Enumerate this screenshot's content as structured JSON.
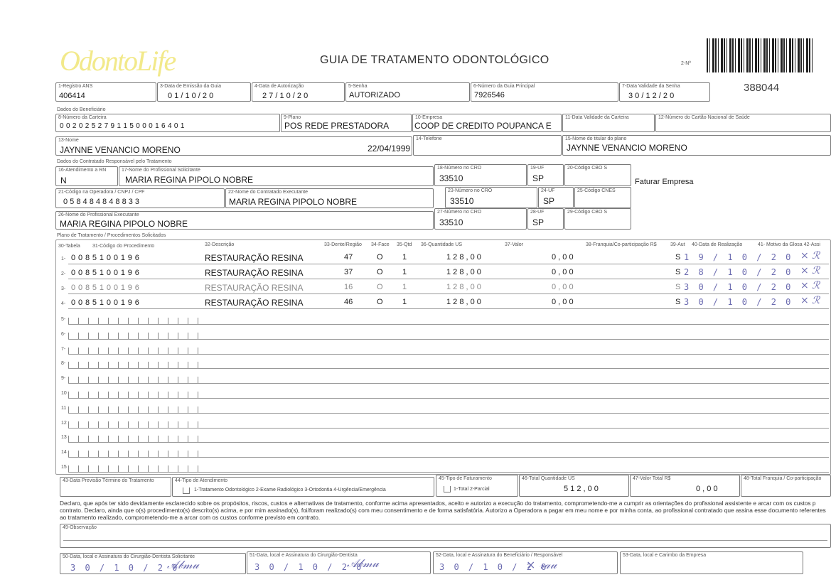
{
  "header": {
    "logo": "OdontoLife",
    "title": "GUIA DE TRATAMENTO ODONTOLÓGICO",
    "guide_no_label": "2-Nº",
    "guide_no": "388044"
  },
  "top": {
    "ans_label": "1-Registro ANS",
    "ans": "406414",
    "emissao_label": "3-Data de Emissão da Guia",
    "emissao": "0 1 / 1 0 / 2 0",
    "autorizacao_label": "4-Data de Autorização",
    "autorizacao": "2 7 / 1 0 / 2 0",
    "senha_label": "5-Senha",
    "senha": "AUTORIZADO",
    "guia_principal_label": "6-Número da Guia Principal",
    "guia_principal": "7926546",
    "validade_senha_label": "7-Data Validade da Senha",
    "validade_senha": "3 0 / 1 2 / 2 0"
  },
  "beneficiario": {
    "section": "Dados do Beneficiário",
    "carteira_label": "8-Número da Carteira",
    "carteira": "0 0 2 0 2 5 2 7 9 1 1 5 0 0 0 1 6 4 0 1",
    "plano_label": "9-Plano",
    "plano": "POS REDE PRESTADORA",
    "empresa_label": "10-Empresa",
    "empresa": "COOP DE CREDITO POUPANCA E",
    "validade_carteira_label": "11-Data Validade da Carteira",
    "cns_label": "12-Número do Cartão Nacional de Saúde",
    "nome_label": "13-Nome",
    "nome": "JAYNNE VENANCIO MORENO",
    "nascimento": "22/04/1999",
    "telefone_label": "14-Telefone",
    "titular_label": "15-Nome do titular do plano",
    "titular": "JAYNNE VENANCIO MORENO"
  },
  "contratado": {
    "section": "Dados do Contratado Responsável pelo Tratamento",
    "rn_label": "16-Atendimento a RN",
    "rn": "N",
    "solicitante_label": "17-Nome do Profissional Solicitante",
    "solicitante": "MARIA REGINA PIPOLO NOBRE",
    "cro_label": "18-Número no CRO",
    "cro": "33510",
    "uf_label": "19-UF",
    "uf": "SP",
    "cbo_label": "20-Código CBO S",
    "faturar": "Faturar Empresa",
    "codigo_op_label": "21-Código na Operadora / CNPJ / CPF",
    "codigo_op": "0 5 8 4 8 4 8 4 8 8 3 3",
    "executante_label": "22-Nome do Contratado Executante",
    "executante": "MARIA REGINA PIPOLO NOBRE",
    "cro2_label": "23-Número no CRO",
    "cro2": "33510",
    "uf2_label": "24-UF",
    "uf2": "SP",
    "cnes_label": "25-Código CNES",
    "prof_exec_label": "26-Nome do Profissional Executante",
    "prof_exec": "MARIA REGINA PIPOLO NOBRE",
    "cro3_label": "27-Número no CRO",
    "cro3": "33510",
    "uf3_label": "28-UF",
    "uf3": "SP",
    "cbo3_label": "29-Código CBO S"
  },
  "plano": {
    "section": "Plano de Tratamento / Procedimentos Solicitados",
    "headers": {
      "tabela": "30-Tabela",
      "codigo": "31-Código do Procedimento",
      "descricao": "32-Descrição",
      "dente": "33-Dente/Região",
      "face": "34-Face",
      "qtd": "35-Qtd",
      "qtd_us": "36-Quantidade US",
      "valor": "37-Valor",
      "franquia": "38-Franquia/Co-participação R$",
      "aut": "39-Aut",
      "data_realizacao": "40-Data de Realização",
      "glosa": "41- Motivo da Glosa 42-Assi"
    },
    "rows": [
      {
        "n": "1-",
        "codigo": "0 0 8 5 1 0 0 1 9 6",
        "descricao": "RESTAURAÇÃO RESINA",
        "dente": "47",
        "face": "O",
        "qtd": "1",
        "us": "1 2 8 , 0 0",
        "franquia": "0 , 0 0",
        "aut": "S",
        "data": "1 9 / 1 0 / 2 0"
      },
      {
        "n": "2-",
        "codigo": "0 0 8 5 1 0 0 1 9 6",
        "descricao": "RESTAURAÇÃO RESINA",
        "dente": "37",
        "face": "O",
        "qtd": "1",
        "us": "1 2 8 , 0 0",
        "franquia": "0 , 0 0",
        "aut": "S",
        "data": "2 8 / 1 0 / 2 0"
      },
      {
        "n": "3-",
        "codigo": "0 0 8 5 1 0 0 1 9 6",
        "descricao": "RESTAURAÇÃO RESINA",
        "dente": "16",
        "face": "O",
        "qtd": "1",
        "us": "1 2 8 , 0 0",
        "franquia": "0 , 0 0",
        "aut": "S",
        "data": "3 0 / 1 0 / 2 0"
      },
      {
        "n": "4-",
        "codigo": "0 0 8 5 1 0 0 1 9 6",
        "descricao": "RESTAURAÇÃO RESINA",
        "dente": "46",
        "face": "O",
        "qtd": "1",
        "us": "1 2 8 , 0 0",
        "franquia": "0 , 0 0",
        "aut": "S",
        "data": "3 0 / 1 0 / 2 0"
      }
    ],
    "empty_rows": [
      "5-",
      "6-",
      "7-",
      "8-",
      "9-",
      "10",
      "11",
      "12",
      "13",
      "14",
      "15"
    ]
  },
  "footer": {
    "previsao_label": "43-Data Previsão Término do Tratamento",
    "tipo_atend_label": "44-Tipo de Atendimento",
    "tipo_atend_opts": "1-Tratamento Odontológico 2-Exame Radiológico 3-Ortodontia 4-Urgência/Emergência",
    "tipo_fat_label": "45-Tipo de Faturamento",
    "tipo_fat_opts": "1-Total 2-Parcial",
    "total_us_label": "46-Total Quantidade US",
    "total_us": "5 1 2 , 0 0",
    "valor_total_label": "47-Valor Total R$",
    "valor_total": "0 , 0 0",
    "total_franquia_label": "48-Total Franquia / Co-participação",
    "declaracao": "Declaro, que após ter sido devidamente esclarecido sobre os propósitos, riscos, custos e alternativas de tratamento, conforme acima apresentados, aceito e autorizo a execução do tratamento, comprometendo-me a cumprir as orientações do profissional assistente e arcar com os custos p contrato. Declaro, ainda que o(s) procedimento(s) descrito(s) acima, e por mim assinado(s), foi/foram realizado(s) com meu consentimento e de forma satisfatória. Autorizo a Operadora a pagar em meu nome e por minha conta, ao profissional contratado que assina esse documento referentes ao tratamento realizado, comprometendo-me a arcar com os custos conforme previsto em contrato.",
    "obs_label": "49-Observação",
    "sig50_label": "50-Data, local e Assinatura do Cirurgião-Dentista Solicitante",
    "sig51_label": "51-Data, local e Assinatura do Cirurgião-Dentista",
    "sig52_label": "52-Data, local e Assinatura do Beneficiário / Responsável",
    "sig53_label": "53-Data, local e Carimbo da Empresa",
    "sig_date": "3 0 / 1 0 / 2 0"
  }
}
